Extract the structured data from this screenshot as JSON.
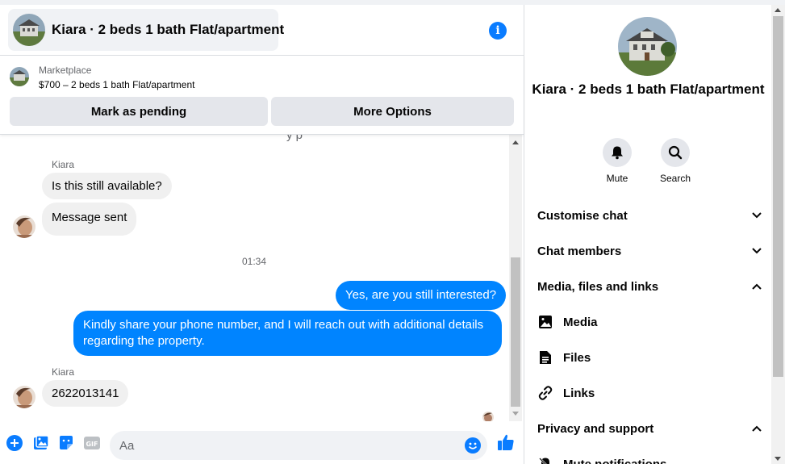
{
  "header": {
    "title": "Kiara · 2 beds 1 bath Flat/apartment"
  },
  "listing": {
    "source": "Marketplace",
    "price_line": "$700 – 2 beds 1 bath Flat/apartment",
    "mark_pending_label": "Mark as pending",
    "more_options_label": "More Options"
  },
  "messages": {
    "cut_off_text": "y p",
    "sender1": "Kiara",
    "msg1": "Is this still available?",
    "msg2": "Message sent",
    "timestamp": "01:34",
    "out1": "Yes, are you still interested?",
    "out2": "Kindly share your phone number, and I will reach out with additional details regarding the property.",
    "sender2": "Kiara",
    "msg3": "2622013141"
  },
  "composer": {
    "placeholder": "Aa"
  },
  "details": {
    "name": "Kiara · 2 beds 1 bath Flat/apartment",
    "actions": [
      {
        "label": "Mute",
        "icon": "bell-icon"
      },
      {
        "label": "Search",
        "icon": "search-icon"
      }
    ],
    "sections": {
      "customise": "Customise chat",
      "members": "Chat members",
      "media_files_links": "Media, files and links",
      "media": "Media",
      "files": "Files",
      "links": "Links",
      "privacy": "Privacy and support",
      "mute_notifications": "Mute notifications"
    }
  },
  "colors": {
    "accent": "#0084ff",
    "incoming_bubble": "#f0f0f0",
    "button_gray": "#e4e6eb"
  }
}
